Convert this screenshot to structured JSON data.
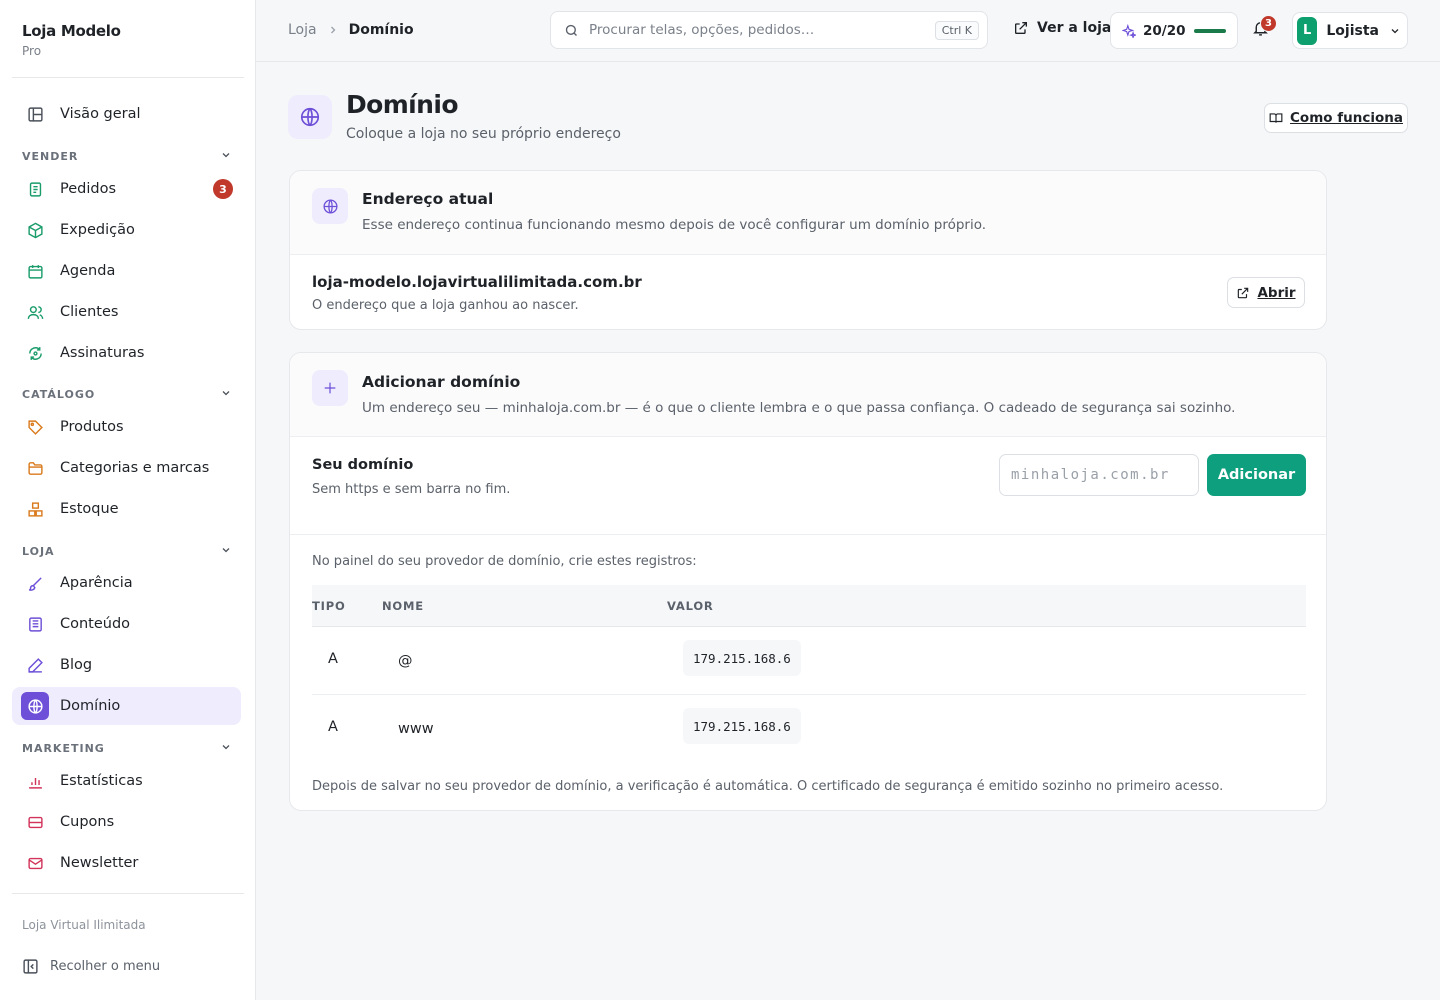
{
  "brand": {
    "name": "Loja Modelo",
    "plan": "Pro"
  },
  "sidebar": {
    "overview": "Visão geral",
    "sections": {
      "vender": "VENDER",
      "catalogo": "CATÁLOGO",
      "loja": "LOJA",
      "marketing": "MARKETING"
    },
    "items": {
      "pedidos": "Pedidos",
      "expedicao": "Expedição",
      "agenda": "Agenda",
      "clientes": "Clientes",
      "assinaturas": "Assinaturas",
      "produtos": "Produtos",
      "categorias": "Categorias e marcas",
      "estoque": "Estoque",
      "aparencia": "Aparência",
      "conteudo": "Conteúdo",
      "blog": "Blog",
      "dominio": "Domínio",
      "estatisticas": "Estatísticas",
      "cupons": "Cupons",
      "newsletter": "Newsletter"
    },
    "pedidos_badge": "3",
    "footer_brand": "Loja Virtual Ilimitada",
    "collapse": "Recolher o menu"
  },
  "topbar": {
    "breadcrumb": [
      "Loja",
      "Domínio"
    ],
    "search_placeholder": "Procurar telas, opções, pedidos…",
    "search_shortcut": "Ctrl K",
    "view_store": "Ver a loja",
    "quota": "20/20",
    "quota_fraction": 1.0,
    "notifications": "3",
    "user_initial": "L",
    "user_name": "Lojista"
  },
  "page": {
    "title": "Domínio",
    "subtitle": "Coloque a loja no seu próprio endereço",
    "how_it_works": "Como funciona"
  },
  "current_address": {
    "title": "Endereço atual",
    "description": "Esse endereço continua funcionando mesmo depois de você configurar um domínio próprio.",
    "address": "loja-modelo.lojavirtualilimitada.com.br",
    "address_hint": "O endereço que a loja ganhou ao nascer.",
    "open_label": "Abrir"
  },
  "add_domain": {
    "title": "Adicionar domínio",
    "description": "Um endereço seu — minhaloja.com.br — é o que o cliente lembra e o que passa confiança. O cadeado de segurança sai sozinho.",
    "field_label": "Seu domínio",
    "field_hint": "Sem https e sem barra no fim.",
    "input_placeholder": "minhaloja.com.br",
    "input_value": "",
    "add_label": "Adicionar",
    "dns_intro": "No painel do seu provedor de domínio, crie estes registros:",
    "columns": [
      "TIPO",
      "NOME",
      "VALOR"
    ],
    "records": [
      {
        "tipo": "A",
        "nome": "@",
        "valor": "179.215.168.6"
      },
      {
        "tipo": "A",
        "nome": "www",
        "valor": "179.215.168.6"
      }
    ],
    "dns_footer": "Depois de salvar no seu provedor de domínio, a verificação é automática. O certificado de segurança é emitido sozinho no primeiro acesso."
  },
  "colors": {
    "accent": "#6d4fd8",
    "primary_button": "#0e9f7e",
    "badge": "#c0392b",
    "quota_bar": "#1b7a4a"
  }
}
